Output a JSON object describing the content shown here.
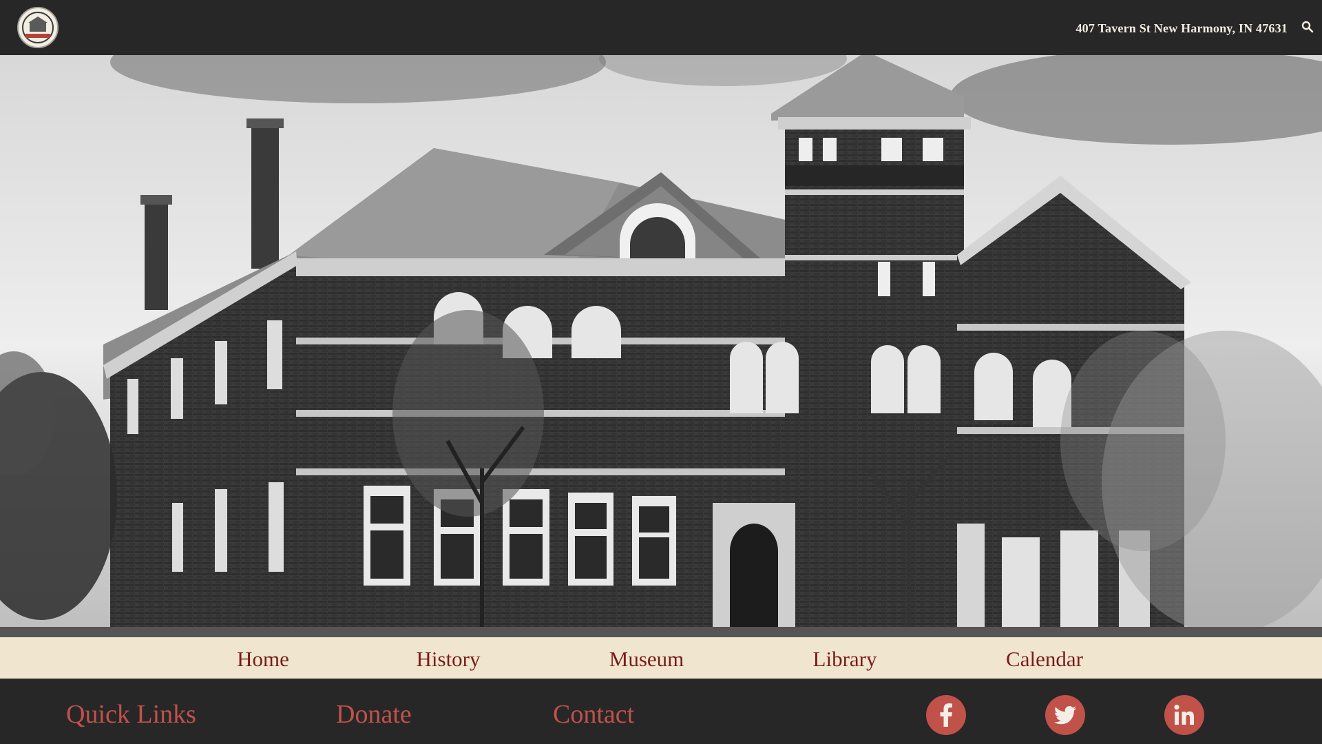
{
  "header": {
    "logo_name": "logo-emblem",
    "address": "407 Tavern St New Harmony, IN 47631",
    "search_icon": "search-icon"
  },
  "hero": {
    "image": "historic-brick-building-photo"
  },
  "nav": {
    "items": [
      {
        "label": "Home"
      },
      {
        "label": "History"
      },
      {
        "label": "Museum"
      },
      {
        "label": "Library"
      },
      {
        "label": "Calendar"
      }
    ]
  },
  "footer": {
    "links": [
      {
        "label": "Quick Links"
      },
      {
        "label": "Donate"
      },
      {
        "label": "Contact"
      }
    ],
    "social": [
      {
        "icon": "facebook-icon"
      },
      {
        "icon": "twitter-icon"
      },
      {
        "icon": "linkedin-icon"
      }
    ]
  },
  "colors": {
    "header_bg": "#272727",
    "nav_bg": "#f0e6d0",
    "nav_text": "#7a1b1b",
    "footer_accent": "#c0524a"
  }
}
